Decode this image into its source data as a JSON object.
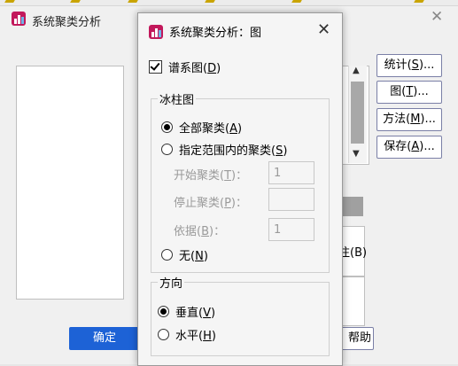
{
  "parent": {
    "title": "系统聚类分析",
    "label_button": "标注个案(B)",
    "label_button_visible": "注(B)",
    "buttons": {
      "statistics": "统计(S)...",
      "plots": "图(T)...",
      "method": "方法(M)...",
      "save": "保存(A)...",
      "ok": "确定",
      "help": "帮助",
      "help_visible": "帮助"
    }
  },
  "dialog": {
    "title": "系统聚类分析：图",
    "dendrogram": {
      "label": "谱系图(D)",
      "checked": true
    },
    "icicle": {
      "title": "冰柱图",
      "options": [
        {
          "label": "全部聚类(A)",
          "selected": true
        },
        {
          "label": "指定范围内的聚类(S)",
          "selected": false
        }
      ],
      "range": {
        "start": {
          "label": "开始聚类(T)：",
          "value": "1"
        },
        "stop": {
          "label": "停止聚类(P)：",
          "value": ""
        },
        "by": {
          "label": "依据(B)：",
          "value": "1"
        }
      },
      "none": {
        "label": "无(N)",
        "selected": false
      }
    },
    "orientation": {
      "title": "方向",
      "options": [
        {
          "label": "垂直(V)",
          "selected": true
        },
        {
          "label": "水平(H)",
          "selected": false
        }
      ]
    }
  },
  "colors": {
    "primary_button": "#1d62d6",
    "button_border": "#7a7fa6"
  }
}
